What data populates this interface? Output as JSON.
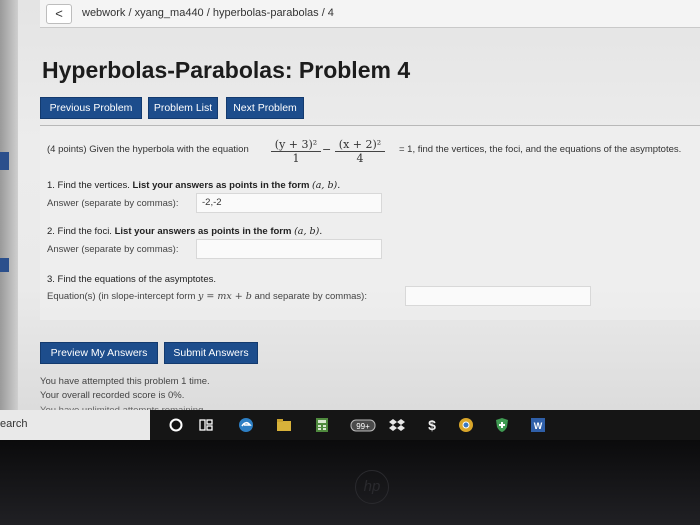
{
  "breadcrumb": {
    "back": "<",
    "path": "webwork / xyang_ma440 / hyperbolas-parabolas / 4"
  },
  "title": "Hyperbolas-Parabolas: Problem 4",
  "nav": {
    "previous": "Previous Problem",
    "list": "Problem List",
    "next": "Next Problem"
  },
  "problem": {
    "intro_lead": "(4 points) Given the hyperbola with the equation",
    "frac1_num": "(y + 3)²",
    "frac1_den": "1",
    "minus": "−",
    "frac2_num": "(x + 2)²",
    "frac2_den": "4",
    "intro_tail": "= 1, find the vertices, the foci, and the equations of the asymptotes.",
    "q1_text": "1. Find the vertices.",
    "q1_bold": "List your answers as points in the form",
    "q1_point": "(a, b).",
    "q1_label": "Answer (separate by commas):",
    "q1_value": "-2,-2",
    "q2_text": "2. Find the foci.",
    "q2_bold": "List your answers as points in the form",
    "q2_point": "(a, b).",
    "q2_label": "Answer (separate by commas):",
    "q2_value": "",
    "q3_text": "3. Find the equations of the asymptotes.",
    "q3_label_pre": "Equation(s) (in slope-intercept form",
    "q3_math": "y = mx + b",
    "q3_label_post": "and separate by commas):",
    "q3_value": ""
  },
  "actions": {
    "preview": "Preview My Answers",
    "submit": "Submit Answers"
  },
  "status": {
    "attempts": "You have attempted this problem 1 time.",
    "score": "Your overall recorded score is 0%.",
    "unlimited": "You have unlimited attempts remaining."
  },
  "taskbar": {
    "search_text": "earch",
    "icons": [
      "cortana-circle-icon",
      "task-view-icon",
      "edge-icon",
      "file-explorer-icon",
      "calculator-icon",
      "badge-99-icon",
      "dropbox-icon",
      "money-icon",
      "chrome-icon",
      "shield-icon",
      "word-icon"
    ],
    "badge": "99+"
  },
  "hardware": {
    "logo": "hp"
  },
  "colors": {
    "button": "#1d4d8c",
    "taskbar": "#151515"
  }
}
